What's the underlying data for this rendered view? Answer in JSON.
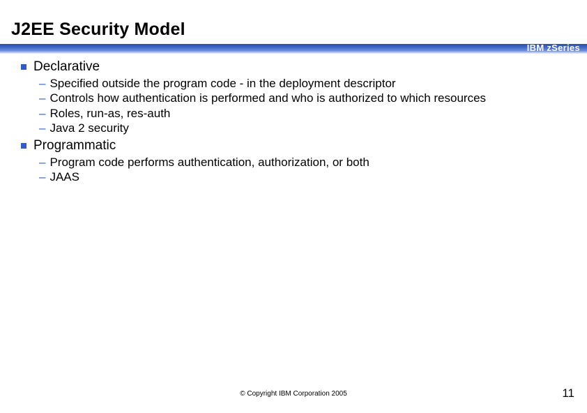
{
  "title": "J2EE Security Model",
  "brand": "IBM zSeries",
  "sections": [
    {
      "heading": "Declarative",
      "items": [
        "Specified outside the program code - in the deployment descriptor",
        "Controls how authentication is performed and who is authorized to which resources",
        "Roles, run-as, res-auth",
        "Java 2 security"
      ]
    },
    {
      "heading": "Programmatic",
      "items": [
        "Program code performs authentication, authorization, or both",
        "JAAS"
      ]
    }
  ],
  "footer": {
    "copyright": "© Copyright IBM Corporation 2005",
    "page": "11"
  }
}
